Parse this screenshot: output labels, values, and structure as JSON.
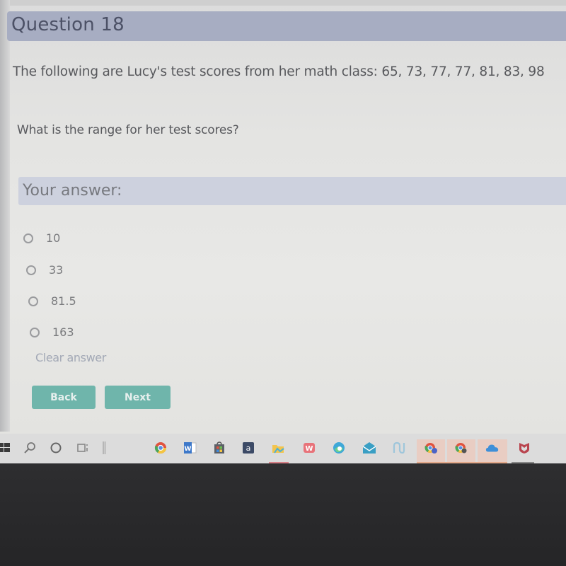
{
  "question": {
    "title": "Question 18",
    "text": "The following are Lucy's test scores from her math class: 65, 73, 77, 77, 81, 83, 98",
    "prompt": "What is the range for her test scores?"
  },
  "answer": {
    "label": "Your answer:",
    "options": [
      {
        "label": "10",
        "selected": false
      },
      {
        "label": "33",
        "selected": false
      },
      {
        "label": "81.5",
        "selected": false
      },
      {
        "label": "163",
        "selected": false
      }
    ],
    "clear_label": "Clear answer"
  },
  "nav": {
    "back_label": "Back",
    "next_label": "Next"
  },
  "colors": {
    "header_bg": "#a7adc2",
    "answer_header_bg": "#cdd1de",
    "button_bg": "#6fb5ab",
    "clear_link": "#a3a9b6"
  },
  "taskbar": {
    "icons": [
      "windows-start-icon",
      "search-icon",
      "cortana-icon",
      "task-view-icon",
      "chrome-icon",
      "word-icon",
      "store-icon",
      "amazon-icon",
      "file-explorer-icon",
      "wps-office-icon",
      "edge-icon",
      "mail-icon",
      "network-app-icon",
      "chrome-profile-icon",
      "chrome-profile-icon-2",
      "onedrive-icon",
      "mcafee-icon"
    ]
  }
}
